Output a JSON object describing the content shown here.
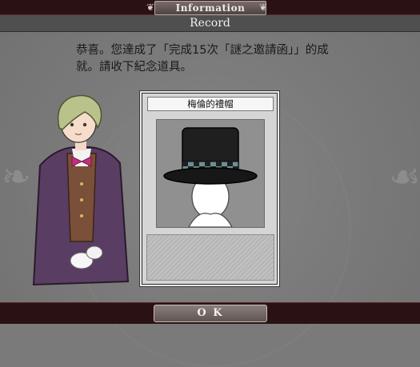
{
  "header": {
    "title": "Information",
    "subtitle": "Record",
    "ornament_left_icon": "fleur-ornament",
    "ornament_right_icon": "fleur-ornament"
  },
  "message": {
    "line1": "恭喜。您達成了「完成15次「謎之邀請函」」的成",
    "line2": "就。請收下紀念道具。"
  },
  "item_card": {
    "name": "梅倫的禮帽",
    "image": "black-top-hat-on-mannequin",
    "description": ""
  },
  "character": {
    "description": "character-portrait"
  },
  "footer": {
    "ok_label": "O K"
  },
  "colors": {
    "frame": "#2a1214",
    "panel": "#7a7a7a",
    "card": "#d5d5d5",
    "hat": "#1f1f1f",
    "hat_band": "#6c8f96"
  }
}
